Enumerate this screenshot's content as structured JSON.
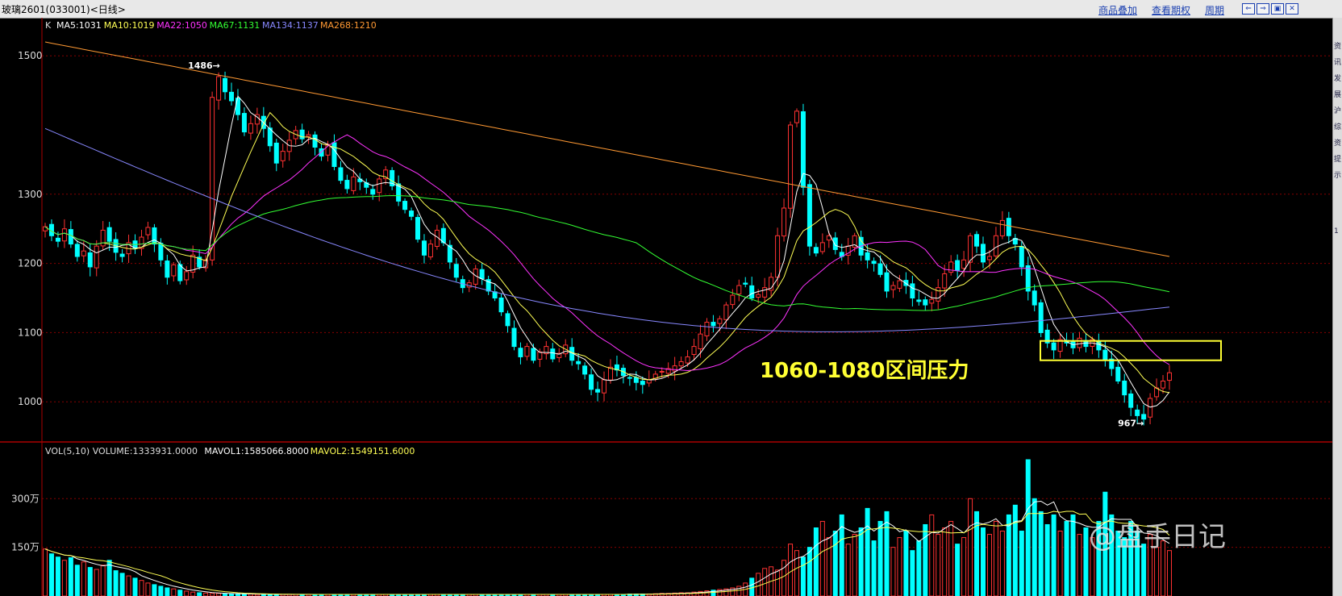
{
  "window": {
    "title": "玻璃2601(033001)<日线>",
    "menus": [
      "商品叠加",
      "查看期权",
      "周期"
    ],
    "controls": [
      "⇐",
      "⇒",
      "▣",
      "✕"
    ]
  },
  "right_strip_glyphs": [
    "资",
    "讯",
    "发",
    "展",
    "沪",
    "综",
    "资",
    "提",
    "示",
    "1"
  ],
  "chart_data": [
    {
      "type": "candlestick",
      "title": "",
      "legend_prefix": "K",
      "y_ticks": [
        1500,
        1300,
        1200,
        1100,
        1000
      ],
      "ylim": [
        942,
        1555
      ],
      "log_scale": false,
      "grid": true,
      "ma_legend": [
        {
          "label": "MA5:1031",
          "color": "#ffffff"
        },
        {
          "label": "MA10:1019",
          "color": "#ffff55"
        },
        {
          "label": "MA22:1050",
          "color": "#ff33ff"
        },
        {
          "label": "MA67:1131",
          "color": "#33ff33"
        },
        {
          "label": "MA134:1137",
          "color": "#8888ff"
        },
        {
          "label": "MA268:1210",
          "color": "#ff9933"
        }
      ],
      "annotations": {
        "high_label": "1486",
        "high_value": 1486,
        "low_label": "967",
        "low_value": 967,
        "pressure_text": "1060-1080区间压力",
        "pressure_zone": [
          1060,
          1088
        ],
        "pressure_color": "#ffff33"
      },
      "close_path": [
        1253,
        1240,
        1232,
        1250,
        1228,
        1210,
        1218,
        1195,
        1225,
        1248,
        1232,
        1216,
        1210,
        1230,
        1222,
        1238,
        1252,
        1228,
        1205,
        1180,
        1198,
        1175,
        1188,
        1212,
        1195,
        1205,
        1440,
        1470,
        1448,
        1435,
        1415,
        1390,
        1402,
        1415,
        1395,
        1370,
        1345,
        1362,
        1378,
        1392,
        1380,
        1386,
        1368,
        1355,
        1372,
        1340,
        1320,
        1308,
        1325,
        1318,
        1310,
        1300,
        1322,
        1335,
        1312,
        1290,
        1278,
        1268,
        1235,
        1212,
        1228,
        1248,
        1230,
        1202,
        1180,
        1165,
        1172,
        1192,
        1178,
        1160,
        1150,
        1130,
        1110,
        1080,
        1065,
        1080,
        1060,
        1072,
        1080,
        1062,
        1070,
        1082,
        1060,
        1055,
        1040,
        1018,
        1014,
        1032,
        1050,
        1046,
        1038,
        1035,
        1028,
        1025,
        1032,
        1040,
        1044,
        1048,
        1052,
        1058,
        1065,
        1080,
        1098,
        1115,
        1110,
        1120,
        1140,
        1154,
        1168,
        1170,
        1150,
        1155,
        1165,
        1180,
        1240,
        1280,
        1400,
        1420,
        1310,
        1225,
        1215,
        1230,
        1240,
        1220,
        1210,
        1225,
        1240,
        1212,
        1205,
        1200,
        1184,
        1160,
        1168,
        1175,
        1168,
        1150,
        1145,
        1140,
        1148,
        1165,
        1185,
        1202,
        1190,
        1205,
        1240,
        1225,
        1202,
        1210,
        1240,
        1262,
        1240,
        1228,
        1195,
        1160,
        1140,
        1100,
        1085,
        1075,
        1090,
        1085,
        1078,
        1092,
        1080,
        1090,
        1075,
        1060,
        1048,
        1030,
        1010,
        992,
        980,
        975,
        1005,
        1020,
        1030,
        1042
      ]
    },
    {
      "type": "bar",
      "legend": "VOL(5,10) VOLUME:1333931.0000",
      "legend_ma": [
        {
          "label": "MAVOL1:1585066.8000",
          "color": "#ffffff"
        },
        {
          "label": "MAVOL2:1549151.6000",
          "color": "#ffff55"
        }
      ],
      "y_ticks": [
        {
          "value": 300,
          "label": "300万"
        },
        {
          "value": 150,
          "label": "150万"
        }
      ],
      "units": "万",
      "ylim": [
        0,
        420
      ],
      "values": [
        145,
        130,
        120,
        110,
        118,
        95,
        105,
        88,
        82,
        95,
        110,
        78,
        70,
        62,
        55,
        48,
        40,
        35,
        30,
        25,
        22,
        18,
        15,
        12,
        10,
        9,
        8,
        8,
        7,
        7,
        6,
        6,
        6,
        5,
        5,
        5,
        5,
        5,
        5,
        5,
        5,
        5,
        5,
        5,
        5,
        5,
        5,
        5,
        5,
        5,
        5,
        5,
        5,
        5,
        5,
        5,
        5,
        5,
        5,
        5,
        5,
        5,
        5,
        5,
        5,
        5,
        5,
        5,
        5,
        5,
        5,
        5,
        5,
        5,
        5,
        5,
        5,
        5,
        5,
        5,
        5,
        5,
        5,
        5,
        5,
        5,
        5,
        5,
        5,
        5,
        5,
        6,
        6,
        6,
        6,
        7,
        8,
        8,
        9,
        10,
        10,
        12,
        14,
        16,
        18,
        20,
        22,
        25,
        30,
        40,
        55,
        70,
        85,
        90,
        80,
        110,
        160,
        140,
        120,
        150,
        210,
        230,
        180,
        200,
        250,
        160,
        190,
        210,
        270,
        170,
        230,
        260,
        150,
        180,
        200,
        140,
        170,
        220,
        250,
        190,
        210,
        230,
        160,
        180,
        300,
        260,
        210,
        190,
        230,
        200,
        250,
        280,
        200,
        420,
        300,
        260,
        220,
        250,
        200,
        230,
        250,
        190,
        210,
        180,
        230,
        320,
        250,
        200,
        180,
        230,
        200,
        160,
        190,
        150,
        170,
        140,
        160,
        130
      ],
      "watermark": "@盘手日记"
    }
  ]
}
